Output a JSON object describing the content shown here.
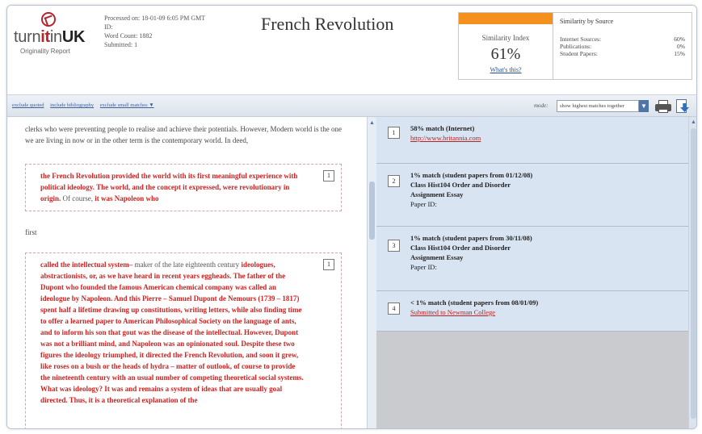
{
  "logo": {
    "word_pre": "turn",
    "word_it": "it",
    "word_post": "in",
    "word_uk": "UK",
    "subtitle": "Originality Report"
  },
  "meta": {
    "processed": "Processed on: 18-01-09 6:05 PM GMT",
    "id": "ID:",
    "word_count": "Word Count: 1882",
    "submitted": "Submitted: 1"
  },
  "document_title": "French Revolution",
  "similarity": {
    "label": "Similarity Index",
    "value": "61%",
    "link": "What's this?",
    "accent": "#f3901e"
  },
  "by_source": {
    "title": "Similarity by Source",
    "rows": [
      {
        "label": "Internet Sources:",
        "value": "60%"
      },
      {
        "label": "Publications:",
        "value": "0%"
      },
      {
        "label": "Student Papers:",
        "value": "15%"
      }
    ]
  },
  "toolbar": {
    "links": [
      "exclude quoted",
      "include bibliography",
      "exclude small matches ▼"
    ],
    "mode_label": "mode:",
    "mode_value": "show highest matches together",
    "select_arrow": "▼",
    "icons": [
      "print-icon",
      "download-icon"
    ]
  },
  "document": {
    "intro": "clerks who were preventing people to realise and achieve their potentials. However, Modern world is the one we are living in now or in the other term is the contemporary world. In deed,",
    "block1": {
      "num": "1",
      "matched": "the French Revolution provided the world with its first meaningful experience with political ideology. The world, and the concept it expressed, were revolutionary in origin.",
      "unmatched": " Of course, ",
      "matched_tail": "it was Napoleon who"
    },
    "between": "first",
    "block2": {
      "num": "1",
      "matched_a": "called the intellectual system–",
      "unmatched_a": " maker of the late eighteenth century ",
      "matched_b": "ideologues, abstractionists, or, as we have heard in recent years eggheads. The father of the Dupont who founded the famous American chemical company was called an ideologue by Napoleon. And this Pierre – Samuel Dupont de Nemours (1739 – 1817) spent half a lifetime drawing up constitutions, writing letters, while also finding time to offer a learned paper to American Philosophical Society on the language of ants, and to inform his son that gout was the disease of the intellectual. However, Dupont was not a brilliant mind, and Napoleon was an opinionated soul. Despite these two figures the ideology triumphed, it directed the French Revolution, and soon it grew, like roses on a bush or the heads of hydra – matter of outlook, of course to provide the nineteenth century with an usual number of competing theoretical social systems. What was ideology? It was and remains a system of ideas that are usually goal directed. Thus, it is a theoretical explanation of the"
    }
  },
  "matches": [
    {
      "num": "1",
      "title": "58% match (Internet)",
      "link": "http://www.britannia.com"
    },
    {
      "num": "2",
      "title": "1% match (student papers from 01/12/08)",
      "line2": "Class Hist104 Order and Disorder",
      "line3": "Assignment Essay",
      "line4": "Paper ID:"
    },
    {
      "num": "3",
      "title": "1% match (student papers from 30/11/08)",
      "line2": "Class Hist104 Order and Disorder",
      "line3": "Assignment Essay",
      "line4": "Paper ID:"
    },
    {
      "num": "4",
      "title": "< 1% match (student papers from 08/01/09)",
      "link": "Submitted to Newman College"
    }
  ],
  "scroll": {
    "up": "▲"
  }
}
